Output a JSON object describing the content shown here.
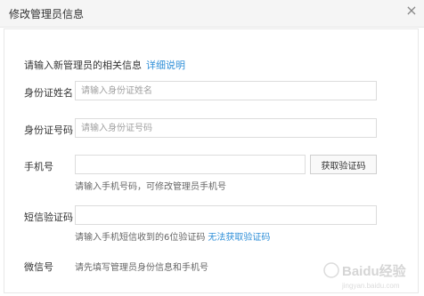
{
  "dialog": {
    "title": "修改管理员信息",
    "close_symbol": "×"
  },
  "intro": {
    "text": "请输入新管理员的相关信息",
    "link": "详细说明"
  },
  "fields": {
    "id_name": {
      "label": "身份证姓名",
      "placeholder": "请输入身份证姓名",
      "value": ""
    },
    "id_number": {
      "label": "身份证号码",
      "placeholder": "请输入身份证号码",
      "value": ""
    },
    "phone": {
      "label": "手机号",
      "placeholder": "",
      "value": "",
      "button": "获取验证码",
      "hint": "请输入手机号码，可修改管理员手机号"
    },
    "sms_code": {
      "label": "短信验证码",
      "placeholder": "",
      "value": "",
      "hint": "请输入手机短信收到的6位验证码",
      "hint_link": "无法获取验证码"
    },
    "wechat": {
      "label": "微信号",
      "note": "请先填写管理员身份信息和手机号"
    }
  },
  "colors": {
    "link": "#2f8fd8",
    "titlebar": "#f5f5f5"
  },
  "watermark": {
    "text": "Baidu经验",
    "sub": "jingyan.baidu.com"
  }
}
